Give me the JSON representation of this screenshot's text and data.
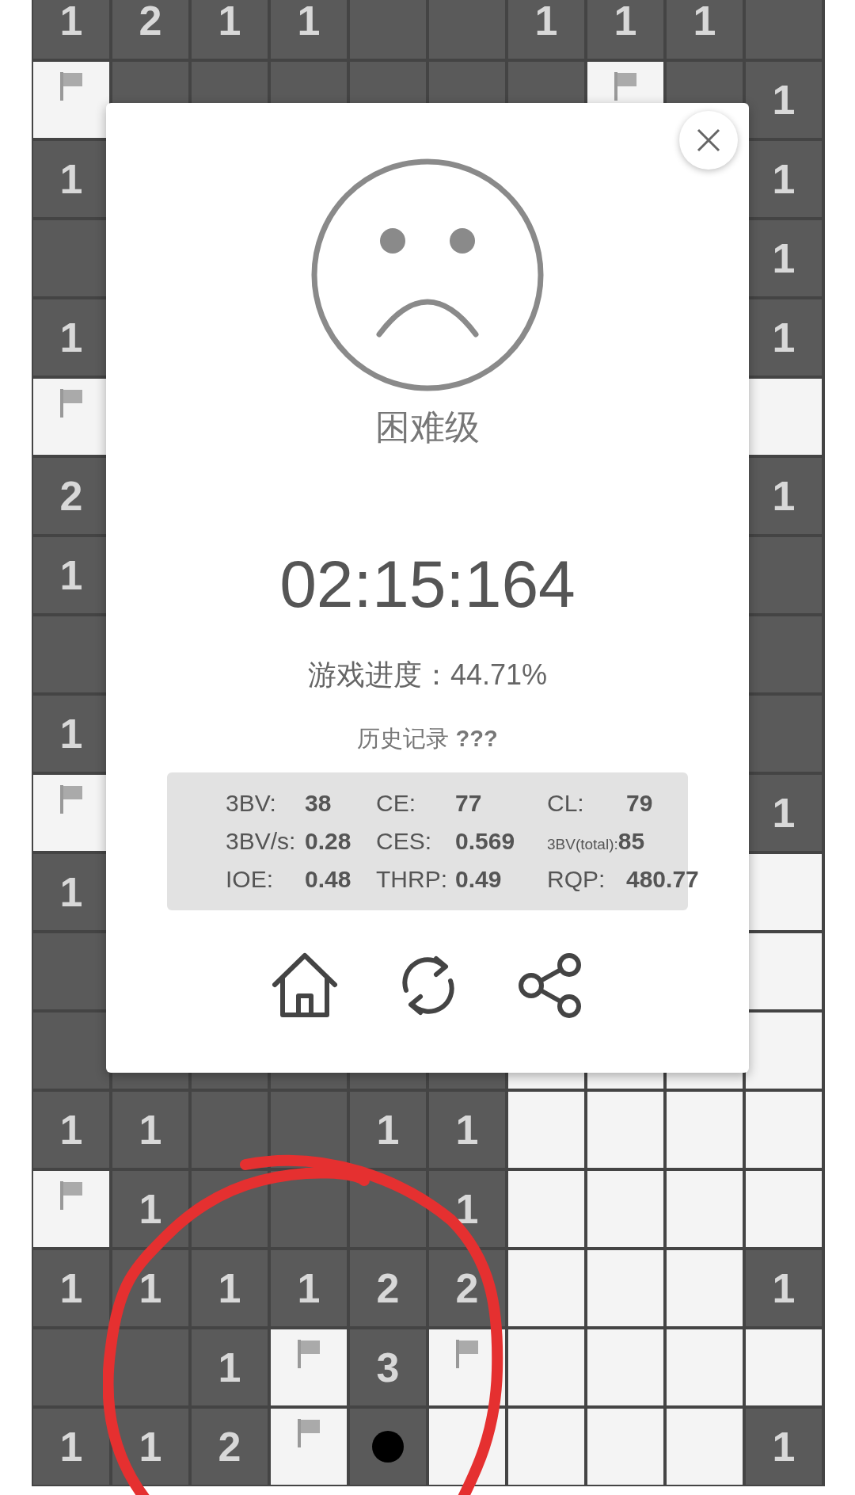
{
  "board": {
    "rows": [
      {
        "cells": [
          {
            "kind": "open",
            "text": "1"
          },
          {
            "kind": "open",
            "text": "2"
          },
          {
            "kind": "open",
            "text": "1"
          },
          {
            "kind": "open",
            "text": "1"
          },
          {
            "kind": "open"
          },
          {
            "kind": "open"
          },
          {
            "kind": "open",
            "text": "1"
          },
          {
            "kind": "open",
            "text": "1"
          },
          {
            "kind": "open",
            "text": "1"
          },
          {
            "kind": "open"
          }
        ]
      },
      {
        "cells": [
          {
            "kind": "flag"
          },
          {
            "kind": "open"
          },
          {
            "kind": "open"
          },
          {
            "kind": "open"
          },
          {
            "kind": "open"
          },
          {
            "kind": "open"
          },
          {
            "kind": "open"
          },
          {
            "kind": "flag"
          },
          {
            "kind": "open"
          },
          {
            "kind": "open",
            "text": "1"
          }
        ]
      },
      {
        "cells": [
          {
            "kind": "open",
            "text": "1"
          },
          null,
          null,
          null,
          null,
          null,
          null,
          null,
          null,
          {
            "kind": "open",
            "text": "1"
          }
        ]
      },
      {
        "cells": [
          {
            "kind": "open"
          },
          null,
          null,
          null,
          null,
          null,
          null,
          null,
          null,
          {
            "kind": "open",
            "text": "1"
          }
        ]
      },
      {
        "cells": [
          {
            "kind": "open",
            "text": "1"
          },
          null,
          null,
          null,
          null,
          null,
          null,
          null,
          null,
          {
            "kind": "open",
            "text": "1"
          }
        ]
      },
      {
        "cells": [
          {
            "kind": "flag"
          },
          null,
          null,
          null,
          null,
          null,
          null,
          null,
          null,
          {
            "kind": "closed"
          }
        ]
      },
      {
        "cells": [
          {
            "kind": "open",
            "text": "2"
          },
          null,
          null,
          null,
          null,
          null,
          null,
          null,
          null,
          {
            "kind": "open",
            "text": "1"
          }
        ]
      },
      {
        "cells": [
          {
            "kind": "open",
            "text": "1"
          },
          null,
          null,
          null,
          null,
          null,
          null,
          null,
          null,
          {
            "kind": "open"
          }
        ]
      },
      {
        "cells": [
          {
            "kind": "open"
          },
          null,
          null,
          null,
          null,
          null,
          null,
          null,
          null,
          {
            "kind": "open"
          }
        ]
      },
      {
        "cells": [
          {
            "kind": "open",
            "text": "1"
          },
          null,
          null,
          null,
          null,
          null,
          null,
          null,
          null,
          {
            "kind": "open"
          }
        ]
      },
      {
        "cells": [
          {
            "kind": "flag"
          },
          null,
          null,
          null,
          null,
          null,
          null,
          null,
          null,
          {
            "kind": "open",
            "text": "1"
          }
        ]
      },
      {
        "cells": [
          {
            "kind": "open",
            "text": "1"
          },
          null,
          null,
          null,
          null,
          null,
          null,
          null,
          null,
          {
            "kind": "closed"
          }
        ]
      },
      {
        "cells": [
          {
            "kind": "open"
          },
          null,
          null,
          null,
          null,
          null,
          null,
          null,
          null,
          {
            "kind": "closed"
          }
        ]
      },
      {
        "cells": [
          {
            "kind": "open"
          },
          {
            "kind": "open"
          },
          {
            "kind": "open"
          },
          {
            "kind": "open"
          },
          {
            "kind": "open"
          },
          {
            "kind": "open"
          },
          {
            "kind": "closed"
          },
          {
            "kind": "closed"
          },
          {
            "kind": "closed"
          },
          {
            "kind": "closed"
          }
        ]
      },
      {
        "cells": [
          {
            "kind": "open",
            "text": "1"
          },
          {
            "kind": "open",
            "text": "1"
          },
          {
            "kind": "open"
          },
          {
            "kind": "open"
          },
          {
            "kind": "open",
            "text": "1"
          },
          {
            "kind": "open",
            "text": "1"
          },
          {
            "kind": "closed"
          },
          {
            "kind": "closed"
          },
          {
            "kind": "closed"
          },
          {
            "kind": "closed"
          }
        ]
      },
      {
        "cells": [
          {
            "kind": "flag"
          },
          {
            "kind": "open",
            "text": "1"
          },
          {
            "kind": "open"
          },
          {
            "kind": "open"
          },
          {
            "kind": "open"
          },
          {
            "kind": "open",
            "text": "1"
          },
          {
            "kind": "closed"
          },
          {
            "kind": "closed"
          },
          {
            "kind": "closed"
          },
          {
            "kind": "closed"
          }
        ]
      },
      {
        "cells": [
          {
            "kind": "open",
            "text": "1"
          },
          {
            "kind": "open",
            "text": "1"
          },
          {
            "kind": "open",
            "text": "1"
          },
          {
            "kind": "open",
            "text": "1"
          },
          {
            "kind": "open",
            "text": "2"
          },
          {
            "kind": "open",
            "text": "2"
          },
          {
            "kind": "closed"
          },
          {
            "kind": "closed"
          },
          {
            "kind": "closed"
          },
          {
            "kind": "open",
            "text": "1"
          }
        ]
      },
      {
        "cells": [
          {
            "kind": "open"
          },
          {
            "kind": "open"
          },
          {
            "kind": "open",
            "text": "1"
          },
          {
            "kind": "flag"
          },
          {
            "kind": "open",
            "text": "3"
          },
          {
            "kind": "flag"
          },
          {
            "kind": "closed"
          },
          {
            "kind": "closed"
          },
          {
            "kind": "closed"
          },
          {
            "kind": "closed"
          }
        ]
      },
      {
        "cells": [
          {
            "kind": "open",
            "text": "1"
          },
          {
            "kind": "open",
            "text": "1"
          },
          {
            "kind": "open",
            "text": "2"
          },
          {
            "kind": "flag"
          },
          {
            "kind": "mine"
          },
          {
            "kind": "closed"
          },
          {
            "kind": "closed"
          },
          {
            "kind": "closed"
          },
          {
            "kind": "closed"
          },
          {
            "kind": "open",
            "text": "1"
          }
        ]
      }
    ]
  },
  "dialog": {
    "difficulty": "困难级",
    "time": "02:15:164",
    "progress": "游戏进度：44.71%",
    "history": "历史记录 **???**",
    "stats": [
      [
        {
          "kind": "normal",
          "label": "3BV:",
          "value": "38"
        },
        {
          "kind": "normal",
          "label": "CE:",
          "value": "77"
        },
        {
          "kind": "normal",
          "label": "CL:",
          "value": "79"
        }
      ],
      [
        {
          "kind": "normal",
          "label": "3BV/s:",
          "value": "0.28"
        },
        {
          "kind": "normal",
          "label": "CES:",
          "value": "0.569"
        },
        {
          "kind": "compact",
          "label": "3BV(total):",
          "value": "85"
        }
      ],
      [
        {
          "kind": "normal",
          "label": "IOE:",
          "value": "0.48"
        },
        {
          "kind": "normal",
          "label": "THRP:",
          "value": "0.49"
        },
        {
          "kind": "normal",
          "label": "RQP:",
          "value": "480.77"
        }
      ]
    ]
  }
}
